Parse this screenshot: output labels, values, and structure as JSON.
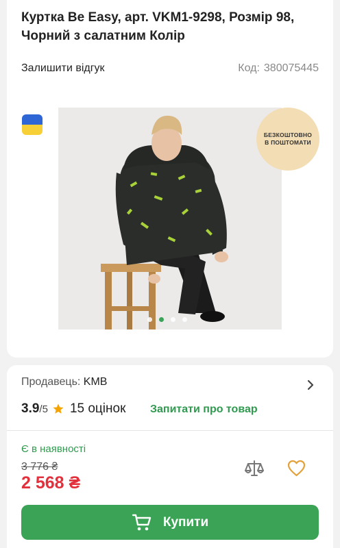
{
  "product": {
    "title": "Куртка Be Easy, арт. VKM1-9298, Розмір 98, Чорний з салатним Колір",
    "review_link": "Залишити відгук",
    "code_label": "Код:",
    "code_value": "380075445"
  },
  "gallery": {
    "badge_line1": "БЕЗКОШТОВНО",
    "badge_line2": "В ПОШТОМАТИ",
    "active_slide": 2,
    "total_slides": 4
  },
  "seller": {
    "label": "Продавець:",
    "name": "KMB"
  },
  "rating": {
    "score": "3.9",
    "max": "/5",
    "count": "15 оцінок"
  },
  "ask_link": "Запитати про товар",
  "availability": "Є в наявності",
  "price": {
    "old": "3 776 ₴",
    "current": "2 568 ₴"
  },
  "buy_button": "Купити",
  "colors": {
    "accent_green": "#3aa355",
    "price_red": "#e2313d",
    "star_orange": "#f4a300",
    "heart_orange": "#e3a13a"
  }
}
